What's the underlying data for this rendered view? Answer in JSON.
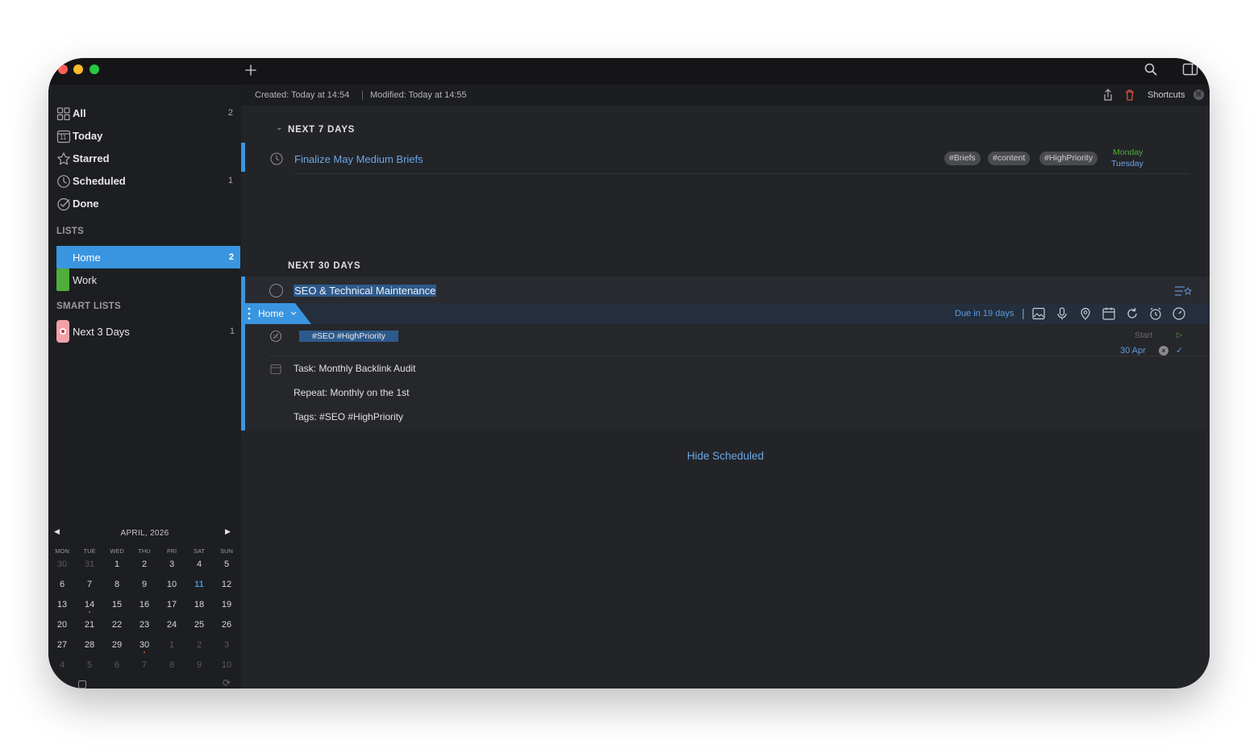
{
  "toolbar": {
    "meta_created": "Created: Today at 14:54",
    "meta_modified": "Modified: Today at 14:55",
    "shortcuts_label": "Shortcuts"
  },
  "sidebar": {
    "items": [
      {
        "label": "All",
        "count": "2"
      },
      {
        "label": "Today",
        "count": ""
      },
      {
        "label": "Starred",
        "count": ""
      },
      {
        "label": "Scheduled",
        "count": "1"
      },
      {
        "label": "Done",
        "count": ""
      }
    ],
    "today_icon_number": "11",
    "lists_header": "LISTS",
    "lists": [
      {
        "label": "Home",
        "count": "2",
        "color": "#3a95e0"
      },
      {
        "label": "Work",
        "count": "",
        "color": "#4fae3a"
      }
    ],
    "smart_lists_header": "SMART LISTS",
    "smart_lists": [
      {
        "label": "Next 3 Days",
        "count": "1",
        "color": "#f3a0a8"
      }
    ]
  },
  "calendar": {
    "month_label": "APRIL, 2026",
    "weekdays": [
      "MON",
      "TUE",
      "WED",
      "THU",
      "FRI",
      "SAT",
      "SUN"
    ],
    "weeks": [
      [
        "30",
        "31",
        "1",
        "2",
        "3",
        "4",
        "5"
      ],
      [
        "6",
        "7",
        "8",
        "9",
        "10",
        "11",
        "12"
      ],
      [
        "13",
        "14",
        "15",
        "16",
        "17",
        "18",
        "19"
      ],
      [
        "20",
        "21",
        "22",
        "23",
        "24",
        "25",
        "26"
      ],
      [
        "27",
        "28",
        "29",
        "30",
        "1",
        "2",
        "3"
      ],
      [
        "4",
        "5",
        "6",
        "7",
        "8",
        "9",
        "10"
      ]
    ],
    "today": "11",
    "dot_days": [
      "14",
      "30"
    ]
  },
  "main": {
    "section1_title": "NEXT 7 DAYS",
    "task1": {
      "title": "Finalize May Medium Briefs",
      "tags": [
        "#Briefs",
        "#content",
        "#HighPriority"
      ],
      "date_top": "Monday",
      "date_bottom": "Tuesday"
    },
    "section2_title": "NEXT 30 DAYS",
    "task2": {
      "title": "SEO & Technical Maintenance",
      "list_name": "Home",
      "due_text": "Due in 19 days",
      "tags_text": "#SEO #HighPriority",
      "start_label": "Start",
      "due_date": "30 Apr",
      "notes": [
        "Task: Monthly Backlink Audit",
        "Repeat: Monthly on the 1st",
        "Tags: #SEO #HighPriority"
      ]
    },
    "hide_scheduled": "Hide Scheduled"
  },
  "colors": {
    "accent": "#3a95e0",
    "green": "#4fae3a",
    "link": "#6aa7e6",
    "selection": "#2d5a8c"
  }
}
